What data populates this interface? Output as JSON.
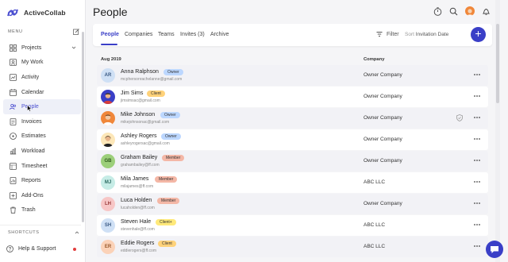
{
  "app": {
    "brand_name": "ActiveCollab",
    "accent": "#3a3fc7"
  },
  "sidebar": {
    "menu_label": "MENU",
    "items": [
      {
        "label": "Projects",
        "icon": "grid-icon"
      },
      {
        "label": "My Work",
        "icon": "person-icon"
      },
      {
        "label": "Activity",
        "icon": "chart-icon"
      },
      {
        "label": "Calendar",
        "icon": "calendar-icon"
      },
      {
        "label": "People",
        "icon": "people-icon"
      },
      {
        "label": "Invoices",
        "icon": "invoice-icon"
      },
      {
        "label": "Estimates",
        "icon": "estimate-icon"
      },
      {
        "label": "Workload",
        "icon": "workload-icon"
      },
      {
        "label": "Timesheet",
        "icon": "timesheet-icon"
      },
      {
        "label": "Reports",
        "icon": "reports-icon"
      },
      {
        "label": "Add-Ons",
        "icon": "addons-icon"
      },
      {
        "label": "Trash",
        "icon": "trash-icon"
      }
    ],
    "shortcuts_label": "SHORTCUTS",
    "help_label": "Help & Support"
  },
  "header": {
    "title": "People"
  },
  "tabs": {
    "people": "People",
    "companies": "Companies",
    "teams": "Teams",
    "invites": "Invites (3)",
    "archive": "Archive",
    "filter": "Filter",
    "sort_label": "Sort",
    "sort_value": "Invitation Date",
    "add": "+"
  },
  "table": {
    "group_label": "Aug 2019",
    "company_header": "Company",
    "rows": [
      {
        "name": "Anna Ralphson",
        "email": "mcphersonrachelanne@gmail.com",
        "role": "Owner",
        "company": "Owner Company",
        "initials": "AR"
      },
      {
        "name": "Jim Sims",
        "email": "jimsimsac@gmail.com",
        "role": "Client",
        "company": "Owner Company",
        "initials": ""
      },
      {
        "name": "Mike Johnson",
        "email": "mikejohnsonac@gmail.com",
        "role": "Owner",
        "company": "Owner Company",
        "initials": ""
      },
      {
        "name": "Ashley Rogers",
        "email": "ashleyrogersac@gmail.com",
        "role": "Owner",
        "company": "Owner Company",
        "initials": ""
      },
      {
        "name": "Graham Bailey",
        "email": "grahambailey@ff.com",
        "role": "Member",
        "company": "Owner Company",
        "initials": "GB"
      },
      {
        "name": "Mila James",
        "email": "milajames@ff.com",
        "role": "Member",
        "company": "ABC LLC",
        "initials": "MJ"
      },
      {
        "name": "Luca Holden",
        "email": "lucaholden@ff.com",
        "role": "Member",
        "company": "Owner Company",
        "initials": "LH"
      },
      {
        "name": "Steven Hale",
        "email": "stevenhale@ff.com",
        "role": "Client+",
        "company": "ABC LLC",
        "initials": "SH"
      },
      {
        "name": "Eddie Rogers",
        "email": "eddierogers@ff.com",
        "role": "Client",
        "company": "ABC LLC",
        "initials": "ER"
      }
    ]
  },
  "colors": {
    "owner_badge": "#bcd7ff",
    "client_badge": "#ffd27a",
    "member_badge": "#f4b7a6",
    "clientplus_badge": "#ffe97a"
  }
}
